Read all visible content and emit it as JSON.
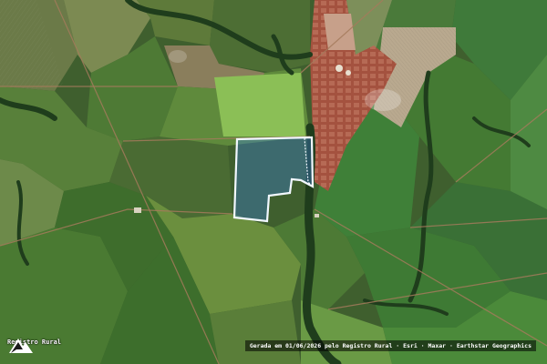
{
  "map": {
    "boundary_color": "#f2f8ff",
    "parcel_fill": "#3b7bd8"
  },
  "logo": {
    "text": "Registro Rural",
    "icon": "registro-rural-logo-icon"
  },
  "attribution": {
    "text": "Gerada em 01/06/2026 pelo Registro Rural · Esri · Maxar · Earthstar Geographics"
  }
}
